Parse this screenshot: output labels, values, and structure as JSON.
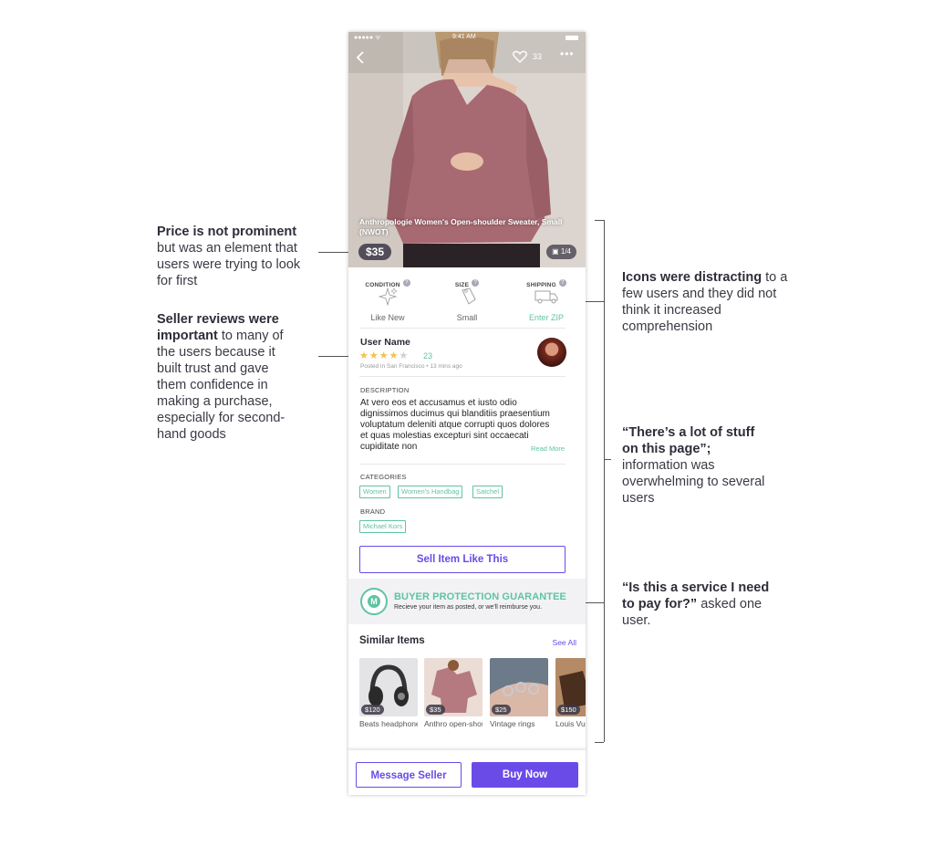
{
  "annotations": {
    "price": {
      "bold": "Price is not prominent",
      "rest": "but was an element that users were trying to look for first"
    },
    "reviews": {
      "bold": "Seller reviews were important",
      "rest": " to many of the users because it built trust and gave them confidence in making a purchase, especially for second-hand goods"
    },
    "icons": {
      "bold": "Icons were distracting",
      "rest": " to a few users and they did not think it increased comprehension"
    },
    "stuff": {
      "bold": "“There’s a lot of stuff on this page”;",
      "rest": "information was overwhelming to several users"
    },
    "service": {
      "bold": "“Is this a service I need to pay for?”",
      "rest": " asked one user."
    }
  },
  "status_bar": {
    "time": "9:41 AM"
  },
  "header": {
    "likes": "33"
  },
  "listing": {
    "title": "Anthropologie Women's Open-shoulder Sweater, Small (NWOT)",
    "price": "$35",
    "photo_index": "1/4"
  },
  "attributes": {
    "condition": {
      "label": "CONDITION",
      "value": "Like New"
    },
    "size": {
      "label": "SIZE",
      "value": "Small"
    },
    "shipping": {
      "label": "SHIPPING",
      "value": "Enter ZIP"
    }
  },
  "seller": {
    "name": "User Name",
    "rating": 4,
    "review_count": "23",
    "posted": "Posted in San Francisco • 13 mins ago"
  },
  "description": {
    "label": "DESCRIPTION",
    "text": "At vero eos et accusamus et iusto odio dignissimos ducimus qui blanditiis praesentium voluptatum deleniti atque corrupti quos dolores et quas molestias excepturi sint occaecati cupiditate non",
    "read_more": "Read More"
  },
  "categories": {
    "label": "CATEGORIES",
    "tags": [
      "Women",
      "Women's Handbag",
      "Satchel"
    ]
  },
  "brand": {
    "label": "BRAND",
    "tag": "Michael Kors"
  },
  "sell_button": "Sell Item Like This",
  "buyer_protection": {
    "title": "BUYER PROTECTION GUARANTEE",
    "subtitle": "Recieve your item as posted, or we'll reimburse you."
  },
  "similar": {
    "title": "Similar Items",
    "see_all": "See All",
    "items": [
      {
        "price": "$120",
        "name": "Beats headphones"
      },
      {
        "price": "$35",
        "name": "Anthro open-shoulder"
      },
      {
        "price": "$25",
        "name": "Vintage rings"
      },
      {
        "price": "$150",
        "name": "Louis Vuitton"
      }
    ]
  },
  "footer": {
    "message": "Message Seller",
    "buy": "Buy Now"
  },
  "colors": {
    "accent": "#6a4be8",
    "green": "#5fc4a0",
    "star": "#f2c14e"
  }
}
